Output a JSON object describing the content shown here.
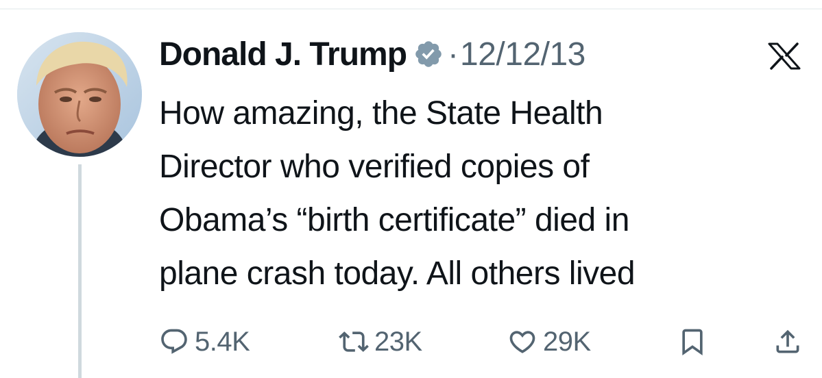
{
  "tweet": {
    "author": {
      "display_name": "Donald J. Trump",
      "verified": true
    },
    "separator": "·",
    "timestamp": "12/12/13",
    "text_lines": [
      "How amazing, the State Health",
      "Director who verified copies of",
      "Obama’s “birth certificate” died in",
      "plane crash today. All others lived"
    ],
    "stats": {
      "replies": "5.4K",
      "retweets": "23K",
      "likes": "29K"
    }
  },
  "icons": {
    "brand": "x-logo",
    "verified": "verified-badge-icon",
    "reply": "reply-icon",
    "retweet": "retweet-icon",
    "like": "heart-icon",
    "bookmark": "bookmark-icon",
    "share": "share-icon"
  },
  "colors": {
    "text_primary": "#0f1419",
    "text_secondary": "#536471",
    "verified_badge": "#829aab",
    "thread_line": "#cfd9de"
  }
}
